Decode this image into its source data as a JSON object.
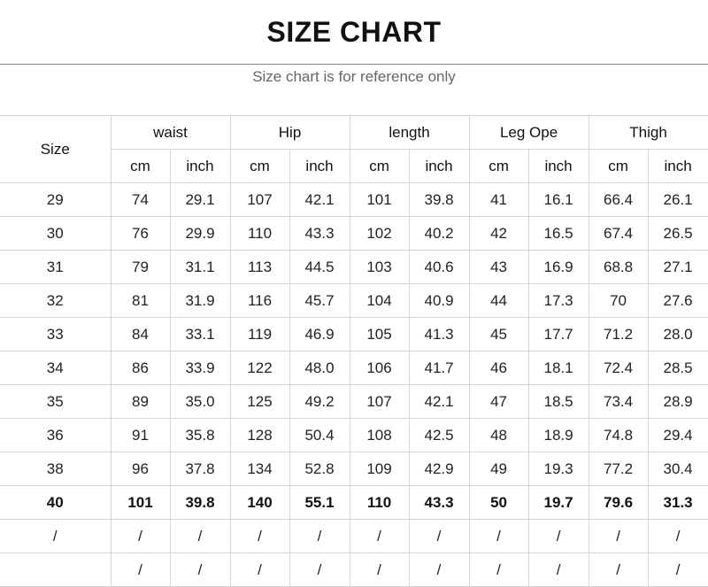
{
  "header": {
    "title": "SIZE CHART",
    "subtitle": "Size chart is for reference only"
  },
  "table": {
    "size_label": "Size",
    "groups": [
      "waist",
      "Hip",
      "length",
      "Leg Ope",
      "Thigh"
    ],
    "units": [
      "cm",
      "inch"
    ],
    "rows": [
      {
        "size": "29",
        "values": [
          "74",
          "29.1",
          "107",
          "42.1",
          "101",
          "39.8",
          "41",
          "16.1",
          "66.4",
          "26.1"
        ]
      },
      {
        "size": "30",
        "values": [
          "76",
          "29.9",
          "110",
          "43.3",
          "102",
          "40.2",
          "42",
          "16.5",
          "67.4",
          "26.5"
        ]
      },
      {
        "size": "31",
        "values": [
          "79",
          "31.1",
          "113",
          "44.5",
          "103",
          "40.6",
          "43",
          "16.9",
          "68.8",
          "27.1"
        ]
      },
      {
        "size": "32",
        "values": [
          "81",
          "31.9",
          "116",
          "45.7",
          "104",
          "40.9",
          "44",
          "17.3",
          "70",
          "27.6"
        ]
      },
      {
        "size": "33",
        "values": [
          "84",
          "33.1",
          "119",
          "46.9",
          "105",
          "41.3",
          "45",
          "17.7",
          "71.2",
          "28.0"
        ]
      },
      {
        "size": "34",
        "values": [
          "86",
          "33.9",
          "122",
          "48.0",
          "106",
          "41.7",
          "46",
          "18.1",
          "72.4",
          "28.5"
        ]
      },
      {
        "size": "35",
        "values": [
          "89",
          "35.0",
          "125",
          "49.2",
          "107",
          "42.1",
          "47",
          "18.5",
          "73.4",
          "28.9"
        ]
      },
      {
        "size": "36",
        "values": [
          "91",
          "35.8",
          "128",
          "50.4",
          "108",
          "42.5",
          "48",
          "18.9",
          "74.8",
          "29.4"
        ]
      },
      {
        "size": "38",
        "values": [
          "96",
          "37.8",
          "134",
          "52.8",
          "109",
          "42.9",
          "49",
          "19.3",
          "77.2",
          "30.4"
        ]
      },
      {
        "size": "40",
        "bold": true,
        "values": [
          "101",
          "39.8",
          "140",
          "55.1",
          "110",
          "43.3",
          "50",
          "19.7",
          "79.6",
          "31.3"
        ]
      },
      {
        "size": "/",
        "values": [
          "/",
          "/",
          "/",
          "/",
          "/",
          "/",
          "/",
          "/",
          "/",
          "/"
        ]
      },
      {
        "size": "",
        "values": [
          "/",
          "/",
          "/",
          "/",
          "/",
          "/",
          "/",
          "/",
          "/",
          "/"
        ]
      }
    ]
  }
}
